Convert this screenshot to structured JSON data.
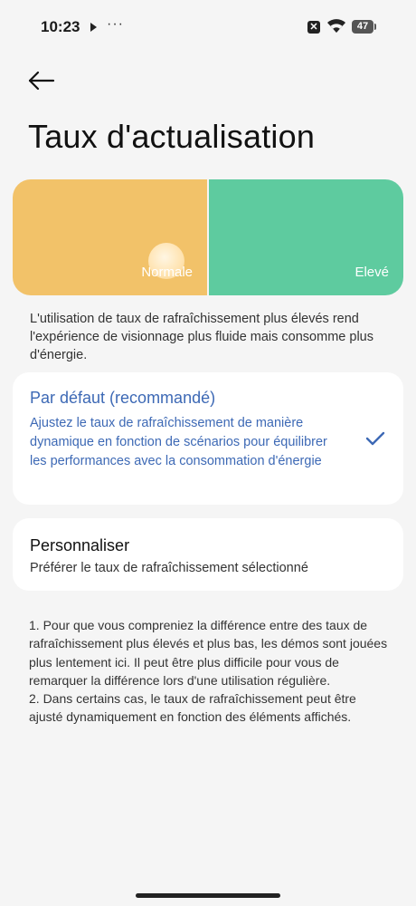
{
  "status_bar": {
    "time": "10:23",
    "more": "···",
    "sim_label": "✕",
    "battery": "47"
  },
  "page": {
    "title": "Taux d'actualisation"
  },
  "rate_selector": {
    "options": [
      {
        "label": "Normale",
        "color": "#f2c269"
      },
      {
        "label": "Elevé",
        "color": "#5ecb9f"
      }
    ]
  },
  "description": "L'utilisation de taux de rafraîchissement plus élevés rend l'expérience de visionnage plus fluide mais consomme plus d'énergie.",
  "options": {
    "default": {
      "title": "Par défaut (recommandé)",
      "subtitle": "Ajustez le taux de rafraîchissement de manière dynamique en fonction de scénarios pour équilibrer les performances avec la consommation d'énergie",
      "accent": "#3d69b5"
    },
    "custom": {
      "title": "Personnaliser",
      "subtitle": "Préférer le taux de rafraîchissement sélectionné"
    }
  },
  "notes": [
    "1. Pour que vous compreniez la différence entre des taux de rafraîchissement plus élevés et plus bas, les démos sont jouées plus lentement ici. Il peut être plus difficile pour vous de remarquer la différence lors d'une utilisation régulière.",
    "2. Dans certains cas, le taux de rafraîchissement peut être ajusté dynamiquement en fonction des éléments affichés."
  ]
}
